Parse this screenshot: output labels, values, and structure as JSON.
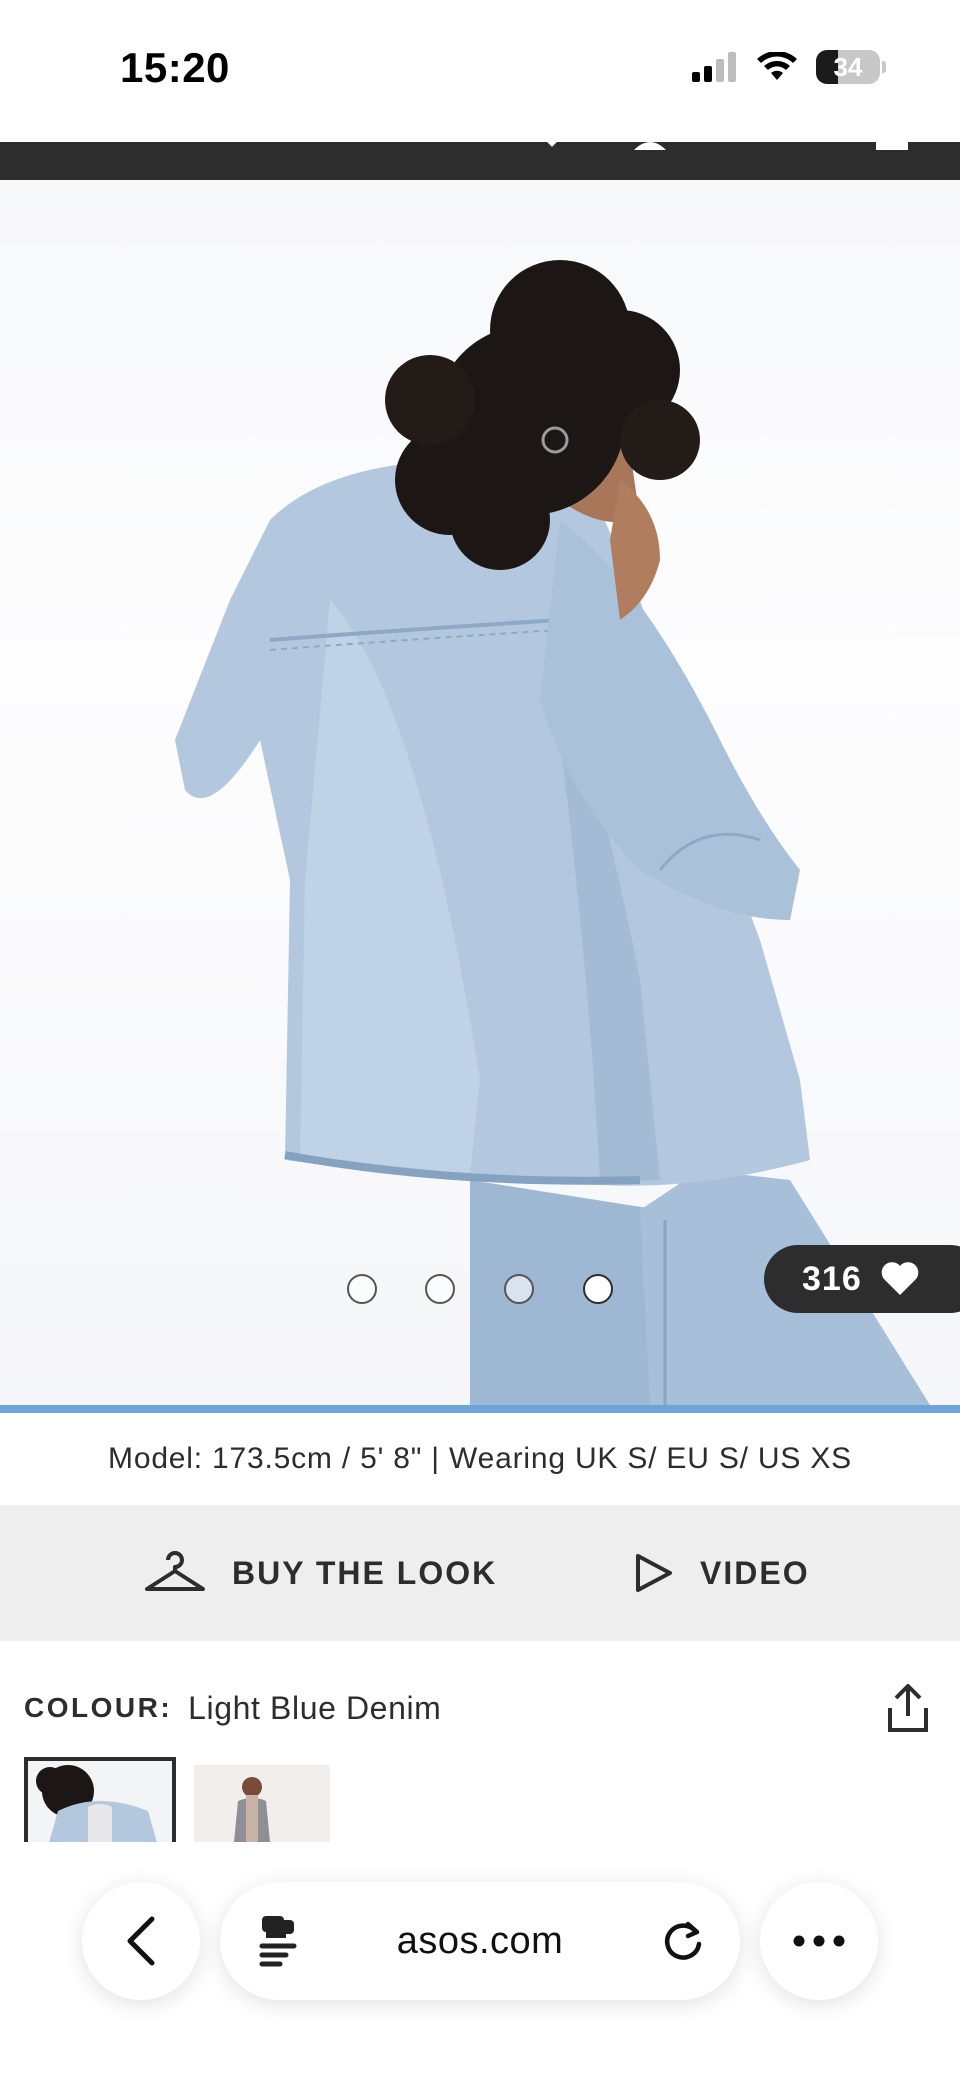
{
  "status_bar": {
    "time": "15:20",
    "battery_level": "34",
    "battery_fraction": 0.34
  },
  "product": {
    "like_count": "316",
    "gallery_total": 4,
    "gallery_active_index": 3,
    "gallery_progress": 1.0
  },
  "model_info": "Model: 173.5cm / 5' 8\" | Wearing UK S/ EU S/ US XS",
  "actions": {
    "buy_the_look": "BUY THE LOOK",
    "video": "VIDEO"
  },
  "colour": {
    "label": "COLOUR:",
    "value": "Light Blue Denim"
  },
  "browser": {
    "url": "asos.com"
  },
  "icons": {
    "status": [
      "signal-icon",
      "wifi-icon",
      "battery-icon"
    ],
    "actions": [
      "hanger-icon",
      "play-icon"
    ],
    "browser": [
      "back-icon",
      "reader-icon",
      "reload-icon",
      "more-icon"
    ],
    "misc": [
      "heart-icon",
      "share-icon"
    ]
  },
  "colors": {
    "text_dark": "#2d2d2d",
    "action_bar_bg": "#eeeeee",
    "progress_accent": "#6ea5d8",
    "denim": "#a9c2dc"
  }
}
